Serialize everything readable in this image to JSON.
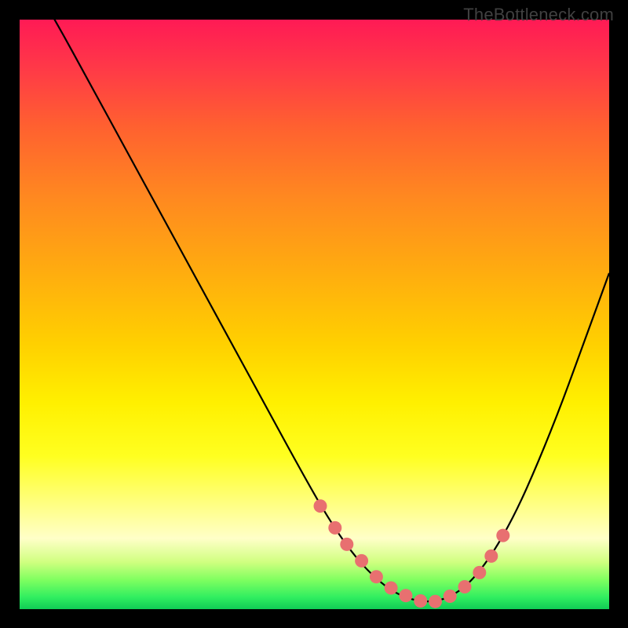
{
  "attribution": "TheBottleneck.com",
  "chart_data": {
    "type": "line",
    "title": "",
    "xlabel": "",
    "ylabel": "",
    "xlim": [
      0,
      100
    ],
    "ylim": [
      0,
      100
    ],
    "series": [
      {
        "name": "bottleneck-curve",
        "x": [
          0,
          6,
          12,
          18,
          24,
          30,
          36,
          42,
          48,
          52,
          56,
          60,
          64,
          68,
          72,
          76,
          80,
          84,
          88,
          92,
          96,
          100
        ],
        "y": [
          110,
          100,
          89,
          78,
          67,
          56,
          45,
          34,
          23,
          16,
          10,
          5.5,
          2.5,
          1.2,
          1.5,
          4,
          9,
          16,
          25,
          35,
          46,
          57
        ]
      }
    ],
    "markers": {
      "name": "highlight-dots",
      "x": [
        51,
        53.5,
        55.5,
        58,
        60.5,
        63,
        65.5,
        68,
        70.5,
        73,
        75.5,
        78,
        80,
        82
      ],
      "y": [
        17.5,
        13.8,
        11,
        8.2,
        5.5,
        3.6,
        2.3,
        1.4,
        1.3,
        2.2,
        3.8,
        6.2,
        9,
        12.5
      ]
    }
  },
  "colors": {
    "background": "#000000",
    "dot": "#e87070"
  }
}
